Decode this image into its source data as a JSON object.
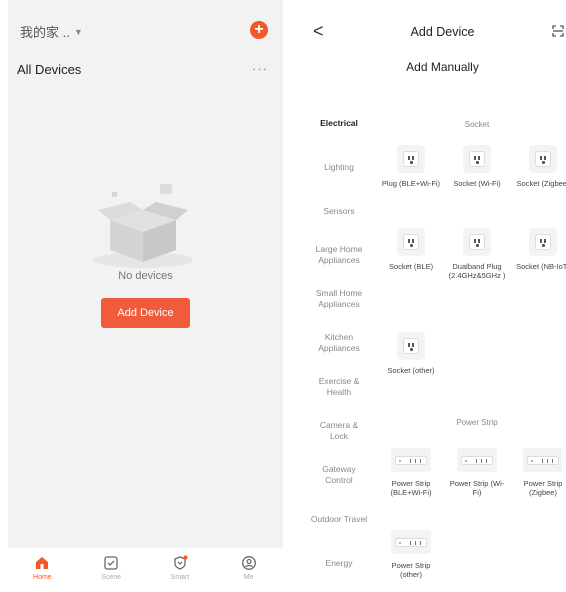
{
  "left": {
    "home_name": "我的家 ..",
    "caret_icon": "caret-down-icon",
    "add_icon": "plus-circle-icon",
    "add_symbol": "+",
    "all_devices": "All Devices",
    "more_symbol": "···",
    "empty_text": "No devices",
    "add_device_label": "Add Device",
    "nav": [
      {
        "label": "Home",
        "icon": "home-icon",
        "active": true
      },
      {
        "label": "Scene",
        "icon": "scene-checkbox-icon",
        "active": false
      },
      {
        "label": "Smart",
        "icon": "smart-shield-icon",
        "active": false
      },
      {
        "label": "Me",
        "icon": "profile-icon",
        "active": false
      }
    ],
    "accent": "#f15a24"
  },
  "right": {
    "back_symbol": "<",
    "title": "Add Device",
    "scan_icon": "scan-frame-icon",
    "subtitle": "Add Manually",
    "categories": [
      {
        "label": "Electrical",
        "active": true
      },
      {
        "label": "Lighting"
      },
      {
        "label": "Sensors"
      },
      {
        "label": "Large Home Appliances"
      },
      {
        "label": "Small Home Appliances"
      },
      {
        "label": "Kitchen Appliances"
      },
      {
        "label": "Exercise & Health"
      },
      {
        "label": "Camera & Lock"
      },
      {
        "label": "Gateway Control"
      },
      {
        "label": "Outdoor Travel"
      },
      {
        "label": "Energy"
      }
    ],
    "socket_section": "Socket",
    "sockets": [
      {
        "name": "Plug (BLE+Wi-Fi)"
      },
      {
        "name": "Socket (Wi-Fi)"
      },
      {
        "name": "Socket (Zigbee)"
      },
      {
        "name": "Socket (BLE)"
      },
      {
        "name": "Dualband Plug (2.4GHz&5GHz )"
      },
      {
        "name": "Socket (NB-IoT)"
      },
      {
        "name": "Socket (other)"
      }
    ],
    "strip_section": "Power Strip",
    "strips": [
      {
        "name": "Power Strip (BLE+Wi-Fi)"
      },
      {
        "name": "Power Strip (Wi-Fi)"
      },
      {
        "name": "Power Strip (Zigbee)"
      },
      {
        "name": "Power Strip (other)"
      }
    ]
  }
}
